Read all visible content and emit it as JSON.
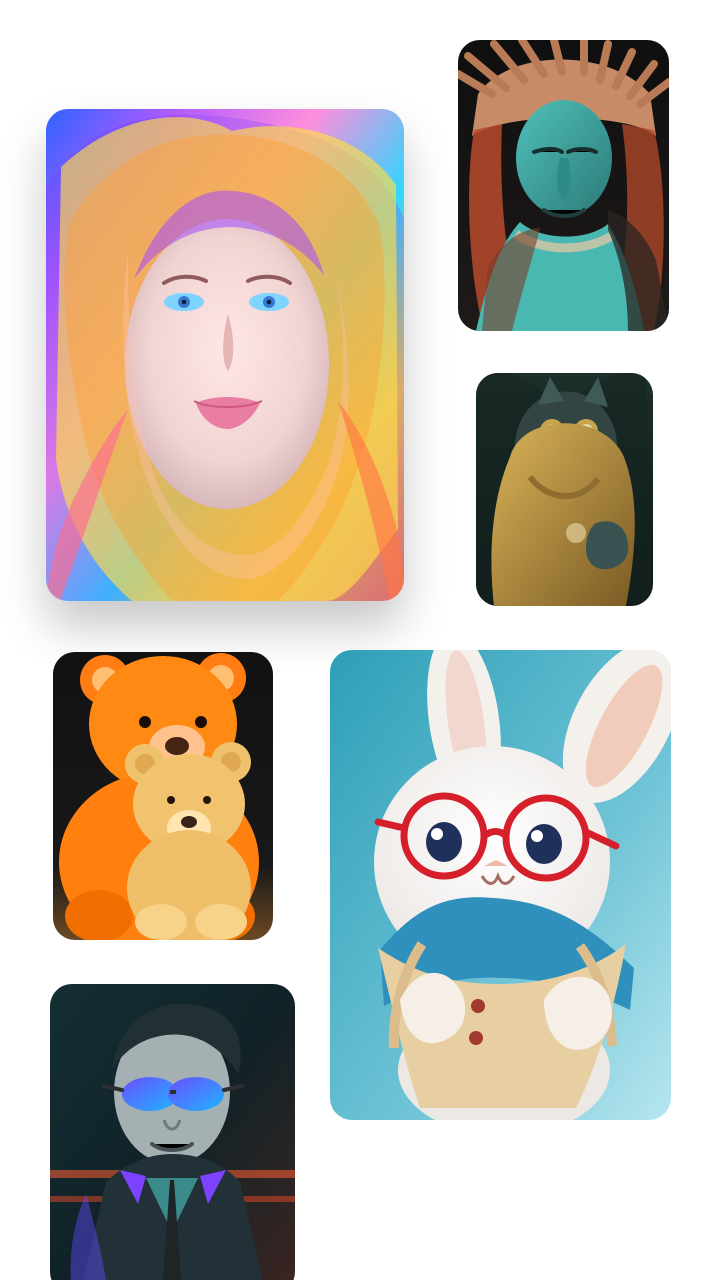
{
  "gallery": {
    "cards": [
      {
        "icon": "rainbow-haired-girl-portrait",
        "accent": "#f8d23c"
      },
      {
        "icon": "native-chief-portrait",
        "accent": "#c98a5f"
      },
      {
        "icon": "hooded-cat-portrait",
        "accent": "#c39a42"
      },
      {
        "icon": "teddy-bears-image",
        "accent": "#ff7d12"
      },
      {
        "icon": "bunny-with-glasses-image",
        "accent": "#72c7da"
      },
      {
        "icon": "boy-with-sunglasses-portrait",
        "accent": "#6c4dff"
      }
    ]
  }
}
